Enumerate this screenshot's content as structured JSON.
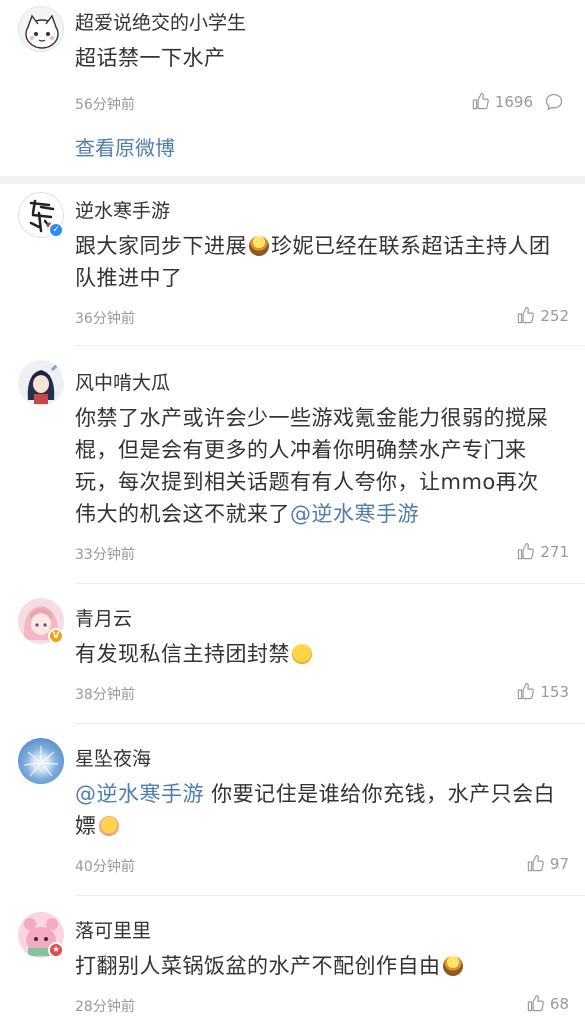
{
  "top": {
    "username": "超爱说绝交的小学生",
    "text": "超话禁一下水产",
    "time": "56分钟前",
    "likes": "1696",
    "view_original": "查看原微博"
  },
  "comments": [
    {
      "username": "逆水寒手游",
      "text_before": "跟大家同步下进展",
      "text_after": "珍妮已经在联系超话主持人团队推进中了",
      "time": "36分钟前",
      "likes": "252"
    },
    {
      "username": "风中啃大瓜",
      "text": "你禁了水产或许会少一些游戏氪金能力很弱的搅屎棍，但是会有更多的人冲着你明确禁水产专门来玩，每次提到相关话题有有人夸你，让mmo再次伟大的机会这不就来了",
      "mention": "@逆水寒手游",
      "time": "33分钟前",
      "likes": "271"
    },
    {
      "username": "青月云",
      "text": "有发现私信主持团封禁",
      "time": "38分钟前",
      "likes": "153"
    },
    {
      "username": "星坠夜海",
      "mention": "@逆水寒手游",
      "text": " 你要记住是谁给你充钱，水产只会白嫖",
      "time": "40分钟前",
      "likes": "97"
    },
    {
      "username": "落可里里",
      "text": "打翻别人菜锅饭盆的水产不配创作自由",
      "time": "28分钟前",
      "likes": "68"
    }
  ],
  "colors": {
    "link": "#507daf",
    "muted": "#999999",
    "verified_badge": "#f0a316",
    "verified_blue": "#2b8cf6",
    "red_badge": "#e84a4a"
  },
  "icons": [
    "thumbs-up-icon",
    "reply-bubble-icon",
    "torch-emoji",
    "smile-emoji",
    "blush-emoji"
  ]
}
